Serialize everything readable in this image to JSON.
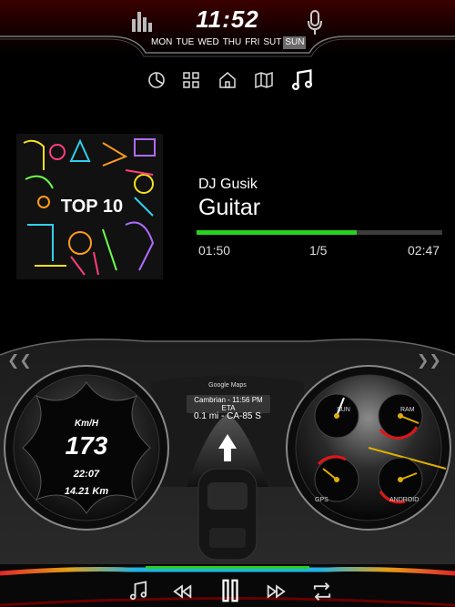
{
  "header": {
    "time": "11:52",
    "days": [
      "MON",
      "TUE",
      "WED",
      "THU",
      "FRI",
      "SUT",
      "SUN"
    ],
    "active_day": "SUN",
    "left_icon": "equalizer-icon",
    "right_icon": "microphone-icon"
  },
  "nav": {
    "items": [
      "pie-chart-icon",
      "grid-icon",
      "home-icon",
      "map-icon",
      "music-icon"
    ],
    "active": "music-icon"
  },
  "player": {
    "album_art_text": "TOP 10",
    "artist": "DJ Gusik",
    "song": "Guitar",
    "current_time": "01:50",
    "track_index": "1/5",
    "total_time": "02:47",
    "progress": 0.65,
    "accent_color": "#27d21f"
  },
  "dashboard": {
    "speed_unit": "Km/H",
    "speed": "173",
    "trip_time": "22:07",
    "distance": "14.21 Km",
    "nav_app": "Google Maps",
    "eta": "Cambrian - 11:56 PM ETA",
    "next_turn": "0.1 mi - CA-85 S",
    "gauge_labels": [
      "SUN",
      "RAM",
      "GPS",
      "ANDROID"
    ]
  },
  "controls": {
    "items": [
      "music-note-icon",
      "rewind-icon",
      "pause-icon",
      "fast-forward-icon",
      "repeat-icon"
    ]
  }
}
